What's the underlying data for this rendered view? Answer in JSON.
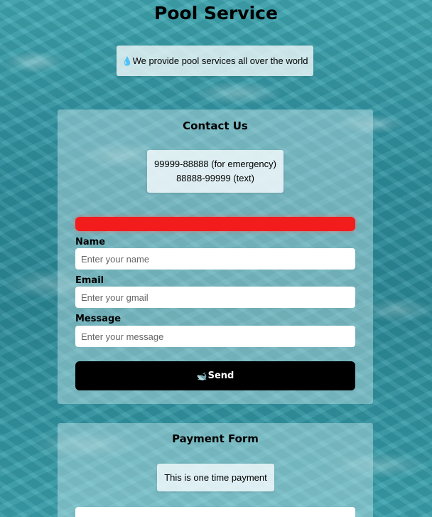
{
  "header": {
    "title": "Pool Service",
    "tagline": "We provide pool services all over the world",
    "tagline_icon": "water-droplet-icon"
  },
  "contact": {
    "title": "Contact Us",
    "phones": [
      "99999-88888 (for emergency)",
      "88888-99999 (text)"
    ],
    "alert_color": "#f21c1c",
    "form": {
      "name_label": "Name",
      "name_placeholder": "Enter your name",
      "name_value": "",
      "email_label": "Email",
      "email_placeholder": "Enter your gmail",
      "email_value": "",
      "message_label": "Message",
      "message_placeholder": "Enter your message",
      "message_value": "",
      "send_label": "Send",
      "send_icon": "whale-icon"
    }
  },
  "payment": {
    "title": "Payment Form",
    "note": "This is one time payment"
  },
  "colors": {
    "button_bg": "#000000",
    "button_text": "#ffffff",
    "water": "#2e8f9e"
  }
}
